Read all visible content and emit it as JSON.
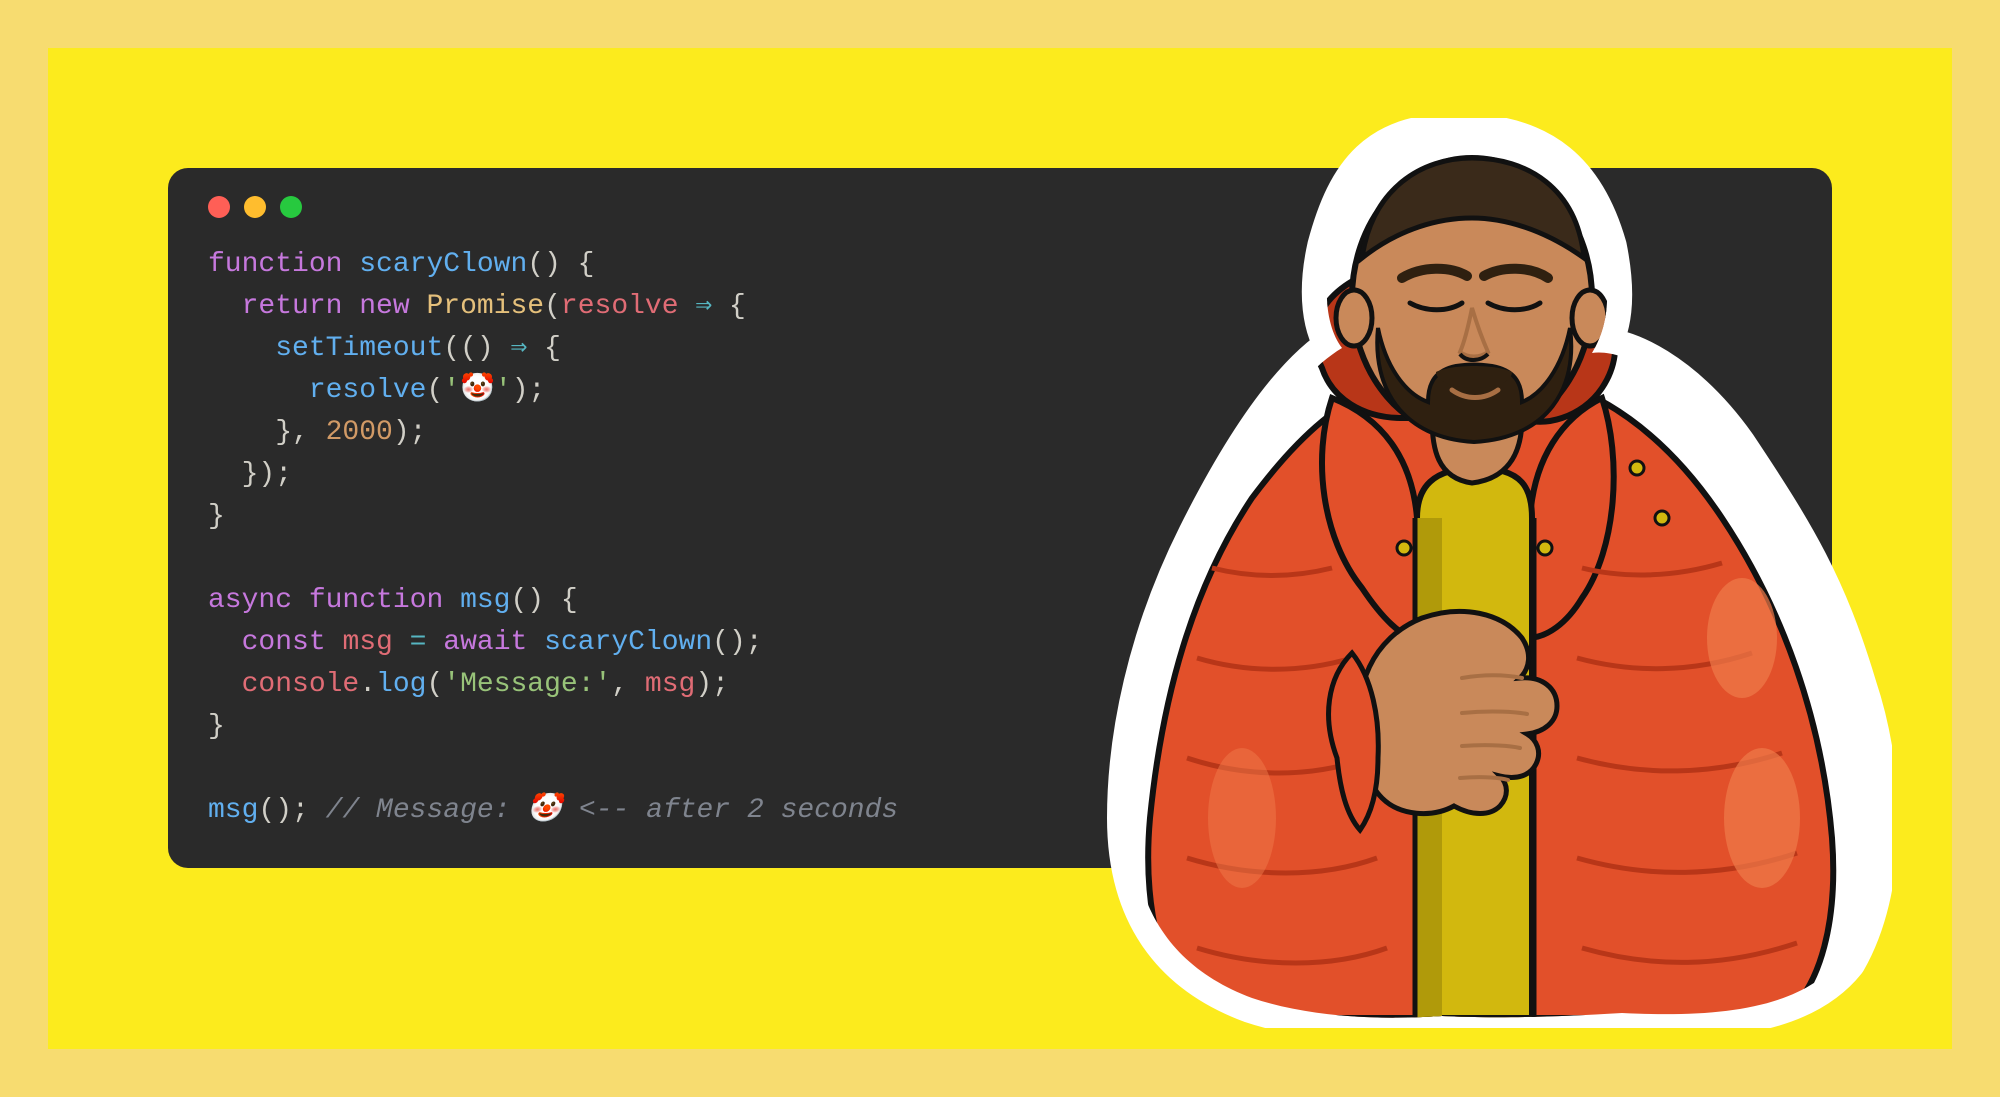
{
  "traffic_lights": {
    "red": "#ff5f56",
    "yellow": "#ffbd2e",
    "green": "#27c93f"
  },
  "code": {
    "line1": {
      "kw1": "function",
      "space1": " ",
      "fn": "scaryClown",
      "punc": "() {"
    },
    "line2": {
      "indent": "  ",
      "kw1": "return",
      "space1": " ",
      "kw2": "new",
      "space2": " ",
      "cls": "Promise",
      "punc1": "(",
      "var": "resolve",
      "space3": " ",
      "op": "⇒",
      "space4": " ",
      "punc2": "{"
    },
    "line3": {
      "indent": "    ",
      "fn": "setTimeout",
      "punc1": "(() ",
      "op": "⇒",
      "punc2": " {"
    },
    "line4": {
      "indent": "      ",
      "fn": "resolve",
      "punc1": "(",
      "str": "'🤡'",
      "punc2": ");"
    },
    "line5": {
      "indent": "    }, ",
      "num": "2000",
      "punc": ");"
    },
    "line6": {
      "indent": "  ",
      "punc": "});"
    },
    "line7": {
      "punc": "}"
    },
    "line8": {
      "blank": ""
    },
    "line9": {
      "kw1": "async",
      "space1": " ",
      "kw2": "function",
      "space2": " ",
      "fn": "msg",
      "punc": "() {"
    },
    "line10": {
      "indent": "  ",
      "kw1": "const",
      "space1": " ",
      "var": "msg",
      "space2": " ",
      "op": "=",
      "space3": " ",
      "kw2": "await",
      "space4": " ",
      "fn": "scaryClown",
      "punc": "();"
    },
    "line11": {
      "indent": "  ",
      "var": "console",
      "punc1": ".",
      "fn": "log",
      "punc2": "(",
      "str": "'Message:'",
      "punc3": ", ",
      "var2": "msg",
      "punc4": ");"
    },
    "line12": {
      "punc": "}"
    },
    "line13": {
      "blank": ""
    },
    "line14": {
      "fn": "msg",
      "punc": "(); ",
      "cmt": "// Message: 🤡 <-- after 2 seconds"
    }
  },
  "sticker": {
    "name": "meme-illustration",
    "jacket_color": "#e2502a",
    "jacket_highlight": "#f07a4a",
    "jacket_shadow": "#b83618",
    "shirt_color": "#d2b80e",
    "shirt_shadow": "#b09a0a",
    "skin_color": "#c9895a",
    "skin_shadow": "#a86f44",
    "hair_color": "#3a2a1a",
    "beard_color": "#2f2010",
    "outline": "#111111",
    "white_border": "#ffffff",
    "logo_color": "#111111"
  }
}
